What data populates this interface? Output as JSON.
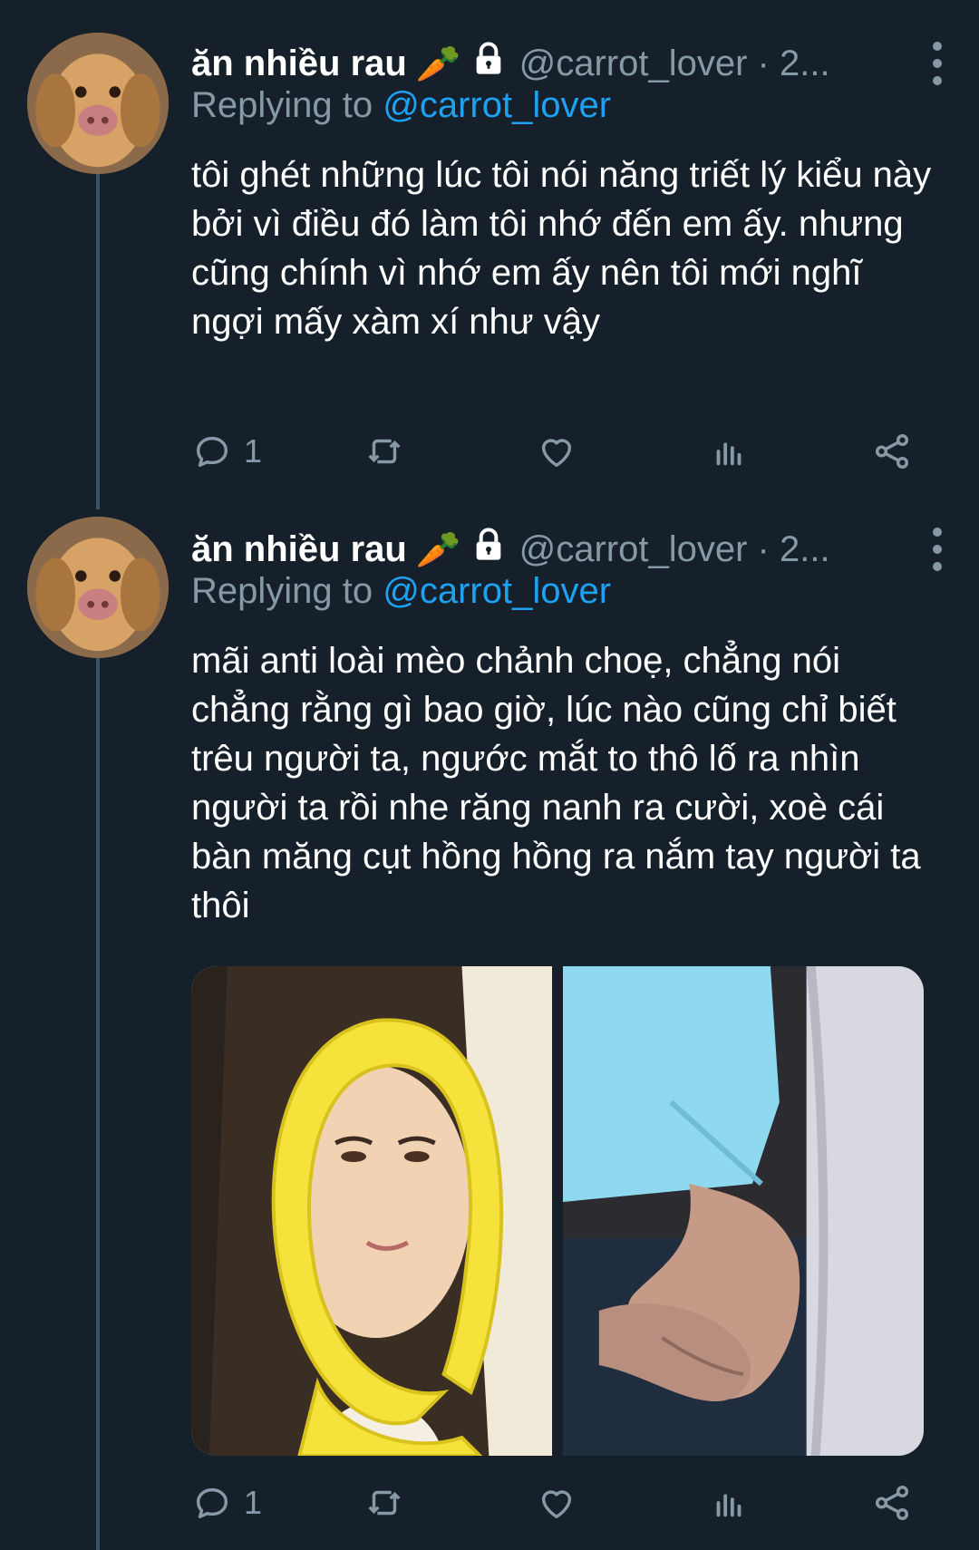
{
  "tweets": [
    {
      "display_name": "ăn nhiều rau",
      "name_emoji": "🥕",
      "handle_meta": "@carrot_lover · 2...",
      "replying_prefix": "Replying to",
      "replying_mention": "@carrot_lover",
      "text": "tôi ghét những lúc tôi nói năng triết lý kiểu này bởi vì điều đó làm tôi nhớ đến em ấy. nhưng cũng chính vì nhớ em ấy nên tôi mới nghĩ ngợi mấy xàm xí như vậy",
      "reply_count": "1"
    },
    {
      "display_name": "ăn nhiều rau",
      "name_emoji": "🥕",
      "handle_meta": "@carrot_lover · 2...",
      "replying_prefix": "Replying to",
      "replying_mention": "@carrot_lover",
      "text": "mãi anti loài mèo chảnh choẹ, chẳng nói chẳng rằng gì bao giờ, lúc nào cũng chỉ biết trêu người ta, ngước mắt to thô lố ra nhìn người ta rồi nhe răng nanh ra cười, xoè cái bàn măng cụt hồng hồng ra nắm tay người ta thôi",
      "reply_count": "1"
    }
  ],
  "colors": {
    "background": "#15202b",
    "secondary_text": "#8899a6",
    "link": "#1da1f2",
    "thread_line": "#3d5466"
  },
  "icons": [
    "reply-icon",
    "retweet-icon",
    "like-icon",
    "analytics-icon",
    "share-icon",
    "lock-icon",
    "more-icon"
  ]
}
